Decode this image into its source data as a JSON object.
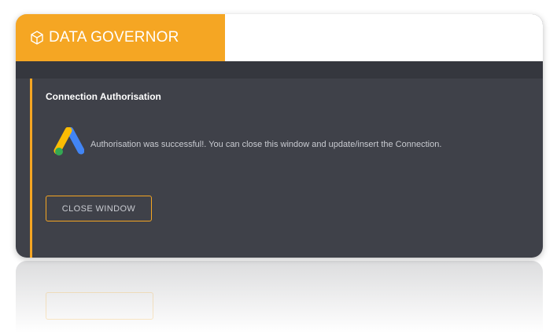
{
  "app": {
    "title": "DATA GOVERNOR",
    "logo_icon": "cube-icon",
    "brand_color": "#f5a623",
    "panel_bg": "#3f4149"
  },
  "panel": {
    "title": "Connection Authorisation",
    "icon": "google-ads-icon",
    "message": "Authorisation was successful!. You can close this window and update/insert the Connection."
  },
  "actions": {
    "close_label": "CLOSE WINDOW"
  }
}
